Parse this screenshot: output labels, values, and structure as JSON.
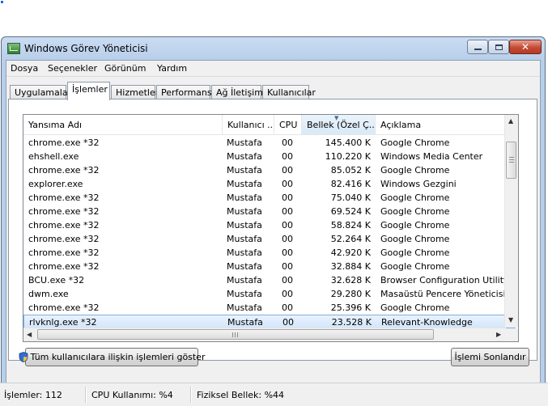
{
  "window": {
    "title": "Windows Görev Yöneticisi"
  },
  "menu": [
    "Dosya",
    "Seçenekler",
    "Görünüm",
    "Yardım"
  ],
  "tabs": [
    "Uygulamalar",
    "İşlemler",
    "Hizmetler",
    "Performans",
    "Ağ İletişimi",
    "Kullanıcılar"
  ],
  "active_tab": "İşlemler",
  "columns": [
    "Yansıma Adı",
    "Kullanıcı ...",
    "CPU",
    "Bellek (Özel Ç...",
    "Açıklama"
  ],
  "rows": [
    {
      "name": "chrome.exe *32",
      "user": "Mustafa",
      "cpu": "00",
      "mem": "145.400 K",
      "desc": "Google Chrome"
    },
    {
      "name": "ehshell.exe",
      "user": "Mustafa",
      "cpu": "00",
      "mem": "110.220 K",
      "desc": "Windows Media Center"
    },
    {
      "name": "chrome.exe *32",
      "user": "Mustafa",
      "cpu": "00",
      "mem": "85.052 K",
      "desc": "Google Chrome"
    },
    {
      "name": "explorer.exe",
      "user": "Mustafa",
      "cpu": "00",
      "mem": "82.416 K",
      "desc": "Windows Gezgini"
    },
    {
      "name": "chrome.exe *32",
      "user": "Mustafa",
      "cpu": "00",
      "mem": "75.040 K",
      "desc": "Google Chrome"
    },
    {
      "name": "chrome.exe *32",
      "user": "Mustafa",
      "cpu": "00",
      "mem": "69.524 K",
      "desc": "Google Chrome"
    },
    {
      "name": "chrome.exe *32",
      "user": "Mustafa",
      "cpu": "00",
      "mem": "58.824 K",
      "desc": "Google Chrome"
    },
    {
      "name": "chrome.exe *32",
      "user": "Mustafa",
      "cpu": "00",
      "mem": "52.264 K",
      "desc": "Google Chrome"
    },
    {
      "name": "chrome.exe *32",
      "user": "Mustafa",
      "cpu": "00",
      "mem": "42.920 K",
      "desc": "Google Chrome"
    },
    {
      "name": "chrome.exe *32",
      "user": "Mustafa",
      "cpu": "00",
      "mem": "32.884 K",
      "desc": "Google Chrome"
    },
    {
      "name": "BCU.exe *32",
      "user": "Mustafa",
      "cpu": "00",
      "mem": "32.628 K",
      "desc": "Browser Configuration Utility"
    },
    {
      "name": "dwm.exe",
      "user": "Mustafa",
      "cpu": "00",
      "mem": "29.280 K",
      "desc": "Masaüstü Pencere Yöneticisi"
    },
    {
      "name": "chrome.exe *32",
      "user": "Mustafa",
      "cpu": "00",
      "mem": "25.396 K",
      "desc": "Google Chrome"
    },
    {
      "name": "rlvknlg.exe *32",
      "user": "Mustafa",
      "cpu": "00",
      "mem": "23.528 K",
      "desc": "Relevant-Knowledge"
    }
  ],
  "selected_row_index": 13,
  "buttons": {
    "show_all": "Tüm kullanıcılara ilişkin işlemleri göster",
    "end_process": "İşlemi Sonlandır"
  },
  "status": {
    "processes": "İşlemler: 112",
    "cpu": "CPU Kullanımı: %4",
    "memory": "Fiziksel Bellek: %44"
  },
  "icons": {
    "app": "task-manager-icon",
    "shield": "uac-shield-icon",
    "colors": {
      "selection": "#d3e6fb",
      "close": "#c44a33"
    }
  }
}
